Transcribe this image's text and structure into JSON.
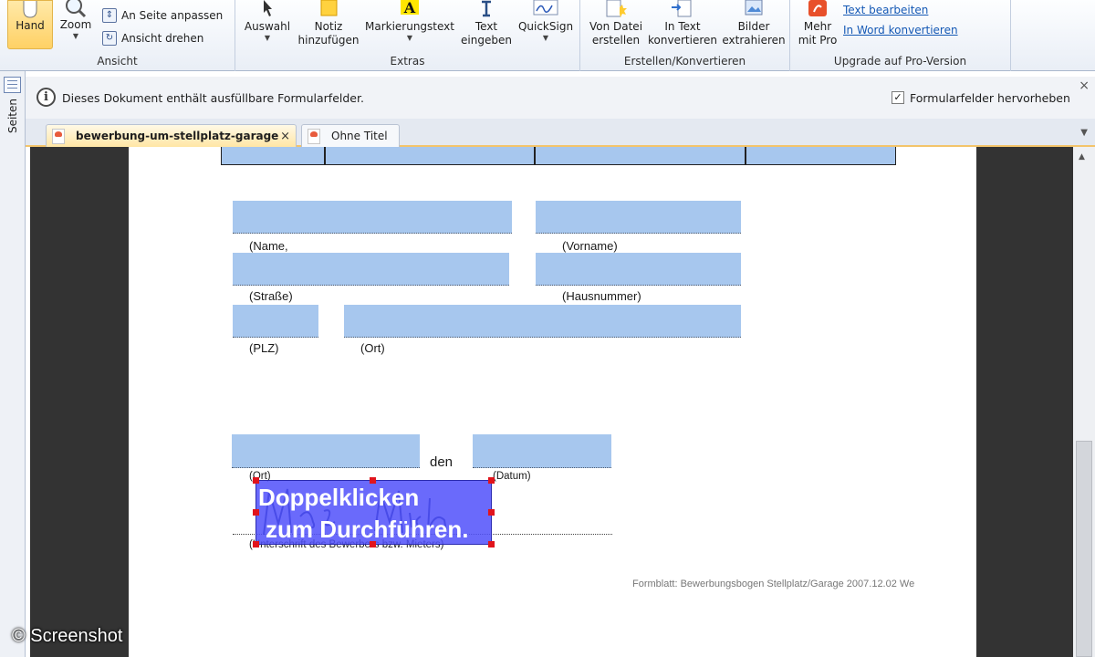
{
  "ribbon": {
    "ansicht": {
      "label": "Ansicht",
      "hand": "Hand",
      "zoom": "Zoom",
      "fit_page": "An Seite anpassen",
      "rotate_view": "Ansicht drehen"
    },
    "extras": {
      "label": "Extras",
      "auswahl": "Auswahl",
      "notiz_1": "Notiz",
      "notiz_2": "hinzufügen",
      "markierung": "Markierungstext",
      "text_1": "Text",
      "text_2": "eingeben",
      "quicksign": "QuickSign"
    },
    "erstellen": {
      "label": "Erstellen/Konvertieren",
      "von_datei_1": "Von Datei",
      "von_datei_2": "erstellen",
      "in_text_1": "In Text",
      "in_text_2": "konvertieren",
      "bilder_1": "Bilder",
      "bilder_2": "extrahieren"
    },
    "upgrade": {
      "label": "Upgrade auf Pro-Version",
      "mehr_1": "Mehr",
      "mehr_2": "mit Pro",
      "text_bearbeiten": "Text bearbeiten",
      "in_word": "In Word konvertieren"
    }
  },
  "notify": {
    "message": "Dieses Dokument enthält ausfüllbare Formularfelder.",
    "highlight_label": "Formularfelder hervorheben",
    "highlight_checked": "✓",
    "close": "×"
  },
  "sidebar": {
    "pages_label": "Seiten"
  },
  "tabs": [
    {
      "label": "bewerbung-um-stellplatz-garage",
      "close": "×"
    },
    {
      "label": "Ohne Titel"
    }
  ],
  "form": {
    "name": "(Name,",
    "vorname": "(Vorname)",
    "strasse": "(Straße)",
    "hausnummer": "(Hausnummer)",
    "plz": "(PLZ)",
    "ort": "(Ort)",
    "den": "den",
    "ort2": "(Ort)",
    "datum": "(Datum)",
    "unterschrift": "(Unterschrift des Bewerbers bzw. Mieters)",
    "signature_overlay_line1": "Doppelklicken",
    "signature_overlay_line2": "zum Durchführen.",
    "footer": "Formblatt: Bewerbungsbogen Stellplatz/Garage 2007.12.02 We"
  },
  "watermark": "© Screenshot",
  "colors": {
    "field": "#a7c7ee",
    "overlay": "#5050fa",
    "handle": "#e1141c",
    "active_tab": "#ffe6a5"
  }
}
